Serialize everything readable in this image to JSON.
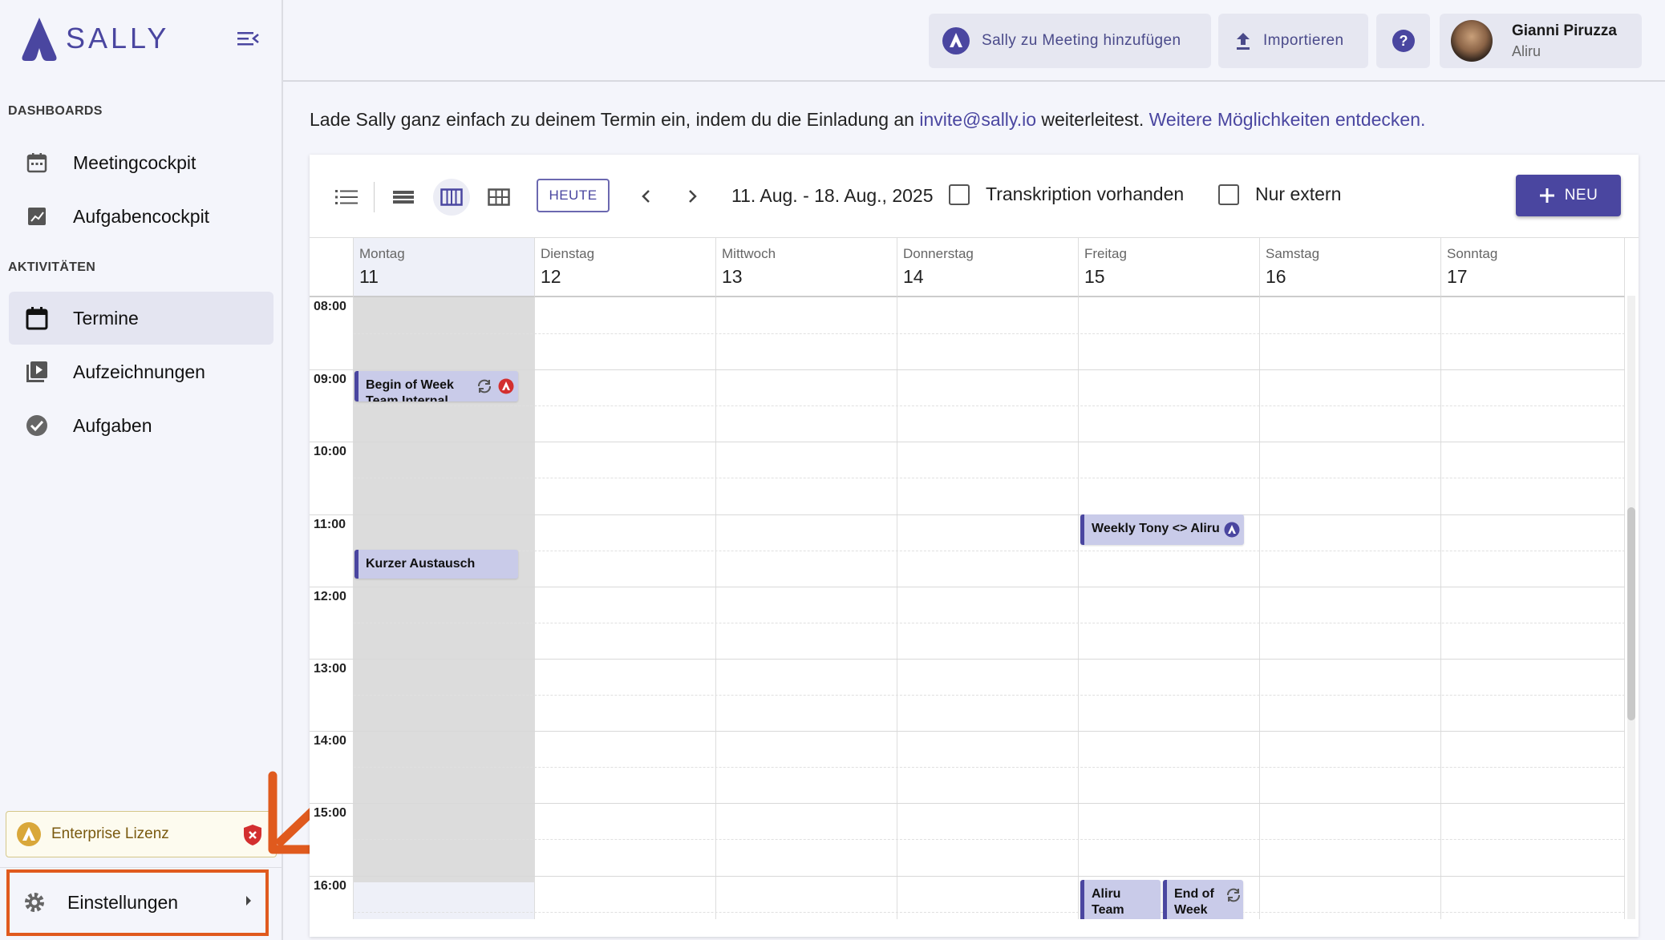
{
  "app": {
    "name": "SALLY"
  },
  "sidebar": {
    "sections": [
      {
        "title": "DASHBOARDS"
      },
      {
        "title": "AKTIVITÄTEN"
      }
    ],
    "items": [
      {
        "label": "Meetingcockpit",
        "icon": "calendar-grid-icon"
      },
      {
        "label": "Aufgabencockpit",
        "icon": "chart-icon"
      },
      {
        "label": "Termine",
        "icon": "calendar-icon",
        "active": true
      },
      {
        "label": "Aufzeichnungen",
        "icon": "video-library-icon"
      },
      {
        "label": "Aufgaben",
        "icon": "check-circle-icon"
      }
    ],
    "license": {
      "label": "Enterprise Lizenz"
    },
    "settings": {
      "label": "Einstellungen"
    }
  },
  "topbar": {
    "add_sally_label": "Sally zu Meeting hinzufügen",
    "import_label": "Importieren",
    "user": {
      "name": "Gianni Piruzza",
      "org": "Aliru"
    }
  },
  "info": {
    "prefix": "Lade Sally ganz einfach zu deinem Termin ein, indem du die Einladung an ",
    "email": "invite@sally.io",
    "middle": " weiterleitest. ",
    "link": "Weitere Möglichkeiten entdecken."
  },
  "calendar": {
    "today_label": "HEUTE",
    "date_range": "11. Aug. - 18. Aug., 2025",
    "filter_transcription": "Transkription vorhanden",
    "filter_external": "Nur extern",
    "new_label": "NEU",
    "days": [
      {
        "name": "Montag",
        "num": "11"
      },
      {
        "name": "Dienstag",
        "num": "12"
      },
      {
        "name": "Mittwoch",
        "num": "13"
      },
      {
        "name": "Donnerstag",
        "num": "14"
      },
      {
        "name": "Freitag",
        "num": "15"
      },
      {
        "name": "Samstag",
        "num": "16"
      },
      {
        "name": "Sonntag",
        "num": "17"
      }
    ],
    "hours": [
      "08:00",
      "09:00",
      "10:00",
      "11:00",
      "12:00",
      "13:00",
      "14:00",
      "15:00",
      "16:00"
    ],
    "events": [
      {
        "title": "Begin of Week",
        "title2": "Team Internal"
      },
      {
        "title": "Kurzer Austausch"
      },
      {
        "title": "Weekly Tony <> Aliru"
      },
      {
        "title": "Aliru",
        "title2": "Team"
      },
      {
        "title": "End of",
        "title2": "Week"
      }
    ]
  },
  "colors": {
    "accent": "#4a46a0",
    "event_bg": "#c9cbe9",
    "today_bg": "#dcdcdc",
    "annotation": "#e05a1e"
  }
}
